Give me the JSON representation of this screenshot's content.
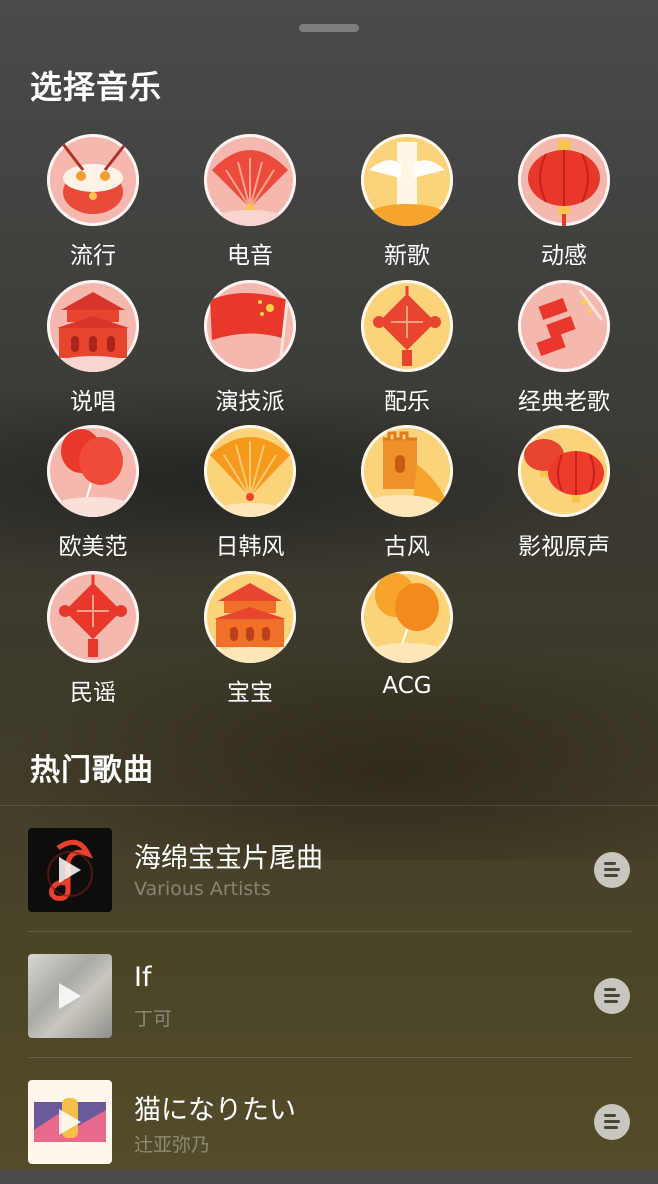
{
  "sheet": {
    "title": "选择音乐"
  },
  "genres": [
    {
      "label": "流行",
      "icon": "drum-icon",
      "tone": "pink"
    },
    {
      "label": "电音",
      "icon": "fan-icon",
      "tone": "pink"
    },
    {
      "label": "新歌",
      "icon": "monument-icon",
      "tone": "gold"
    },
    {
      "label": "动感",
      "icon": "lantern-icon",
      "tone": "pink"
    },
    {
      "label": "说唱",
      "icon": "gate-tower-icon",
      "tone": "pink"
    },
    {
      "label": "演技派",
      "icon": "flag-icon",
      "tone": "pink"
    },
    {
      "label": "配乐",
      "icon": "chinese-knot-icon",
      "tone": "gold"
    },
    {
      "label": "经典老歌",
      "icon": "firecracker-icon",
      "tone": "pink"
    },
    {
      "label": "欧美范",
      "icon": "balloons-icon",
      "tone": "pink"
    },
    {
      "label": "日韩风",
      "icon": "fan-icon",
      "tone": "gold"
    },
    {
      "label": "古风",
      "icon": "great-wall-icon",
      "tone": "gold"
    },
    {
      "label": "影视原声",
      "icon": "lanterns-icon",
      "tone": "gold"
    },
    {
      "label": "民谣",
      "icon": "chinese-knot-icon",
      "tone": "pink"
    },
    {
      "label": "宝宝",
      "icon": "gate-tower-icon",
      "tone": "gold"
    },
    {
      "label": "ACG",
      "icon": "balloons-icon",
      "tone": "gold"
    }
  ],
  "hot": {
    "title": "热门歌曲",
    "songs": [
      {
        "title": "海绵宝宝片尾曲",
        "artist": "Various Artists"
      },
      {
        "title": "If",
        "artist": "丁可"
      },
      {
        "title": "猫になりたい",
        "artist": "辻亚弥乃"
      }
    ]
  }
}
